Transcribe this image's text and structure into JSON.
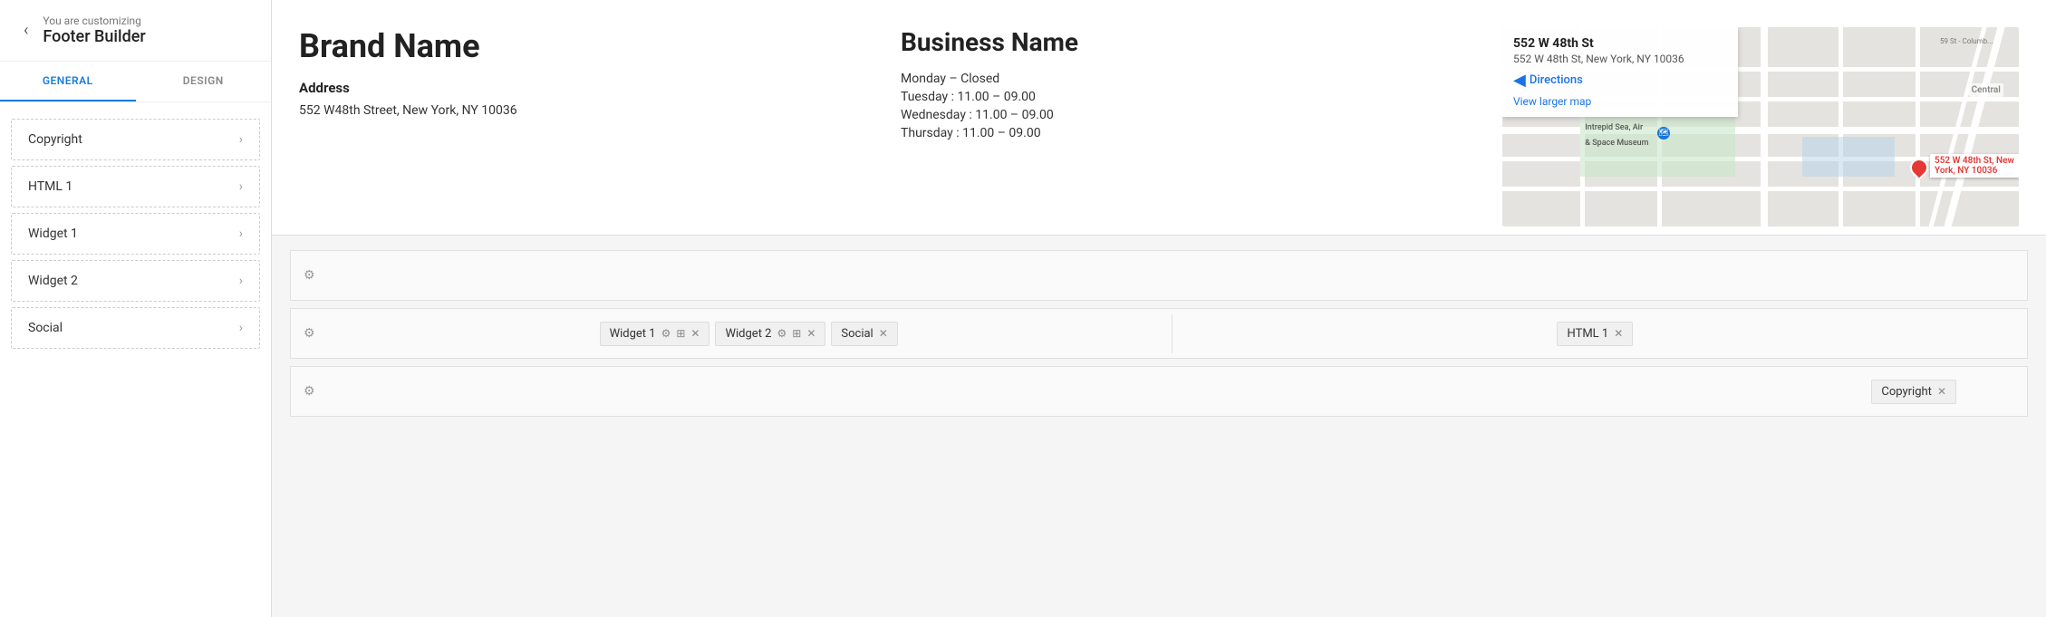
{
  "sidebar": {
    "back_label": "‹",
    "context_label": "You are customizing",
    "title": "Footer Builder",
    "tabs": [
      {
        "id": "general",
        "label": "GENERAL",
        "active": true
      },
      {
        "id": "design",
        "label": "DESIGN",
        "active": false
      }
    ],
    "items": [
      {
        "id": "copyright",
        "label": "Copyright"
      },
      {
        "id": "html1",
        "label": "HTML 1"
      },
      {
        "id": "widget1",
        "label": "Widget 1"
      },
      {
        "id": "widget2",
        "label": "Widget 2"
      },
      {
        "id": "social",
        "label": "Social"
      }
    ]
  },
  "footer_preview": {
    "brand_name": "Brand Name",
    "address_label": "Address",
    "address_text": "552 W48th Street, New York, NY 10036",
    "business_name": "Business Name",
    "hours": [
      "Monday – Closed",
      "Tuesday : 11.00 – 09.00",
      "Wednesday : 11.00 – 09.00",
      "Thursday : 11.00 – 09.00"
    ]
  },
  "map": {
    "place_name": "552 W 48th St",
    "place_address": "552 W 48th St, New York, NY 10036",
    "directions_label": "Directions",
    "larger_map_label": "View larger map",
    "pin_label": "552 W 48th St, New\nYork, NY 10036"
  },
  "builder": {
    "rows": [
      {
        "id": "row1",
        "cols": [
          {
            "widgets": []
          }
        ]
      },
      {
        "id": "row2",
        "cols": [
          {
            "widgets": [
              {
                "label": "Widget 1"
              },
              {
                "label": "Widget 2"
              },
              {
                "label": "Social"
              }
            ]
          },
          {
            "widgets": [
              {
                "label": "HTML 1"
              }
            ]
          }
        ]
      },
      {
        "id": "row3",
        "cols": [
          {
            "widgets": [
              {
                "label": "Copyright"
              }
            ]
          }
        ]
      }
    ],
    "gear_symbol": "⚙",
    "grid_symbol": "⊞",
    "close_symbol": "✕"
  }
}
